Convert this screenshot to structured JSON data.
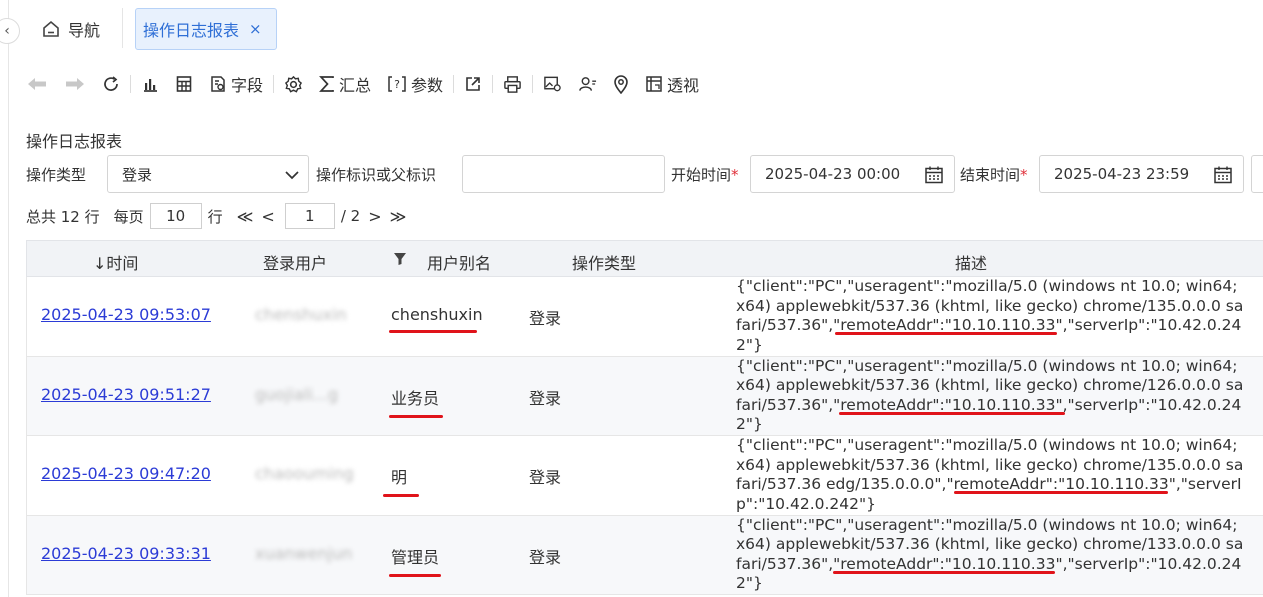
{
  "nav": {
    "home_label": "导航",
    "active_tab": "操作日志报表",
    "close_glyph": "×"
  },
  "toolbar": {
    "back_icon": "arrow-left-icon",
    "forward_icon": "arrow-right-icon",
    "field_label": "字段",
    "summary_label": "汇总",
    "param_label": "参数",
    "pivot_label": "透视"
  },
  "report": {
    "title": "操作日志报表"
  },
  "filters": {
    "op_type_label": "操作类型",
    "op_type_value": "登录",
    "op_id_label": "操作标识或父标识",
    "op_id_value": "",
    "start_label": "开始时间",
    "start_value": "2025-04-23 00:00",
    "end_label": "结束时间",
    "end_value": "2025-04-23 23:59",
    "required_mark": "*"
  },
  "pager": {
    "total_text": "总共 12 行",
    "per_page_label": "每页",
    "per_page_value": "10",
    "row_unit": "行",
    "first_glyph": "≪",
    "prev_glyph": "<",
    "current_page": "1",
    "page_total": "/ 2",
    "next_glyph": ">",
    "last_glyph": "≫"
  },
  "table": {
    "columns": {
      "time": "↓时间",
      "user": "登录用户",
      "alias": "用户别名",
      "type": "操作类型",
      "desc": "描述"
    },
    "rows": [
      {
        "time": "2025-04-23 09:53:07",
        "user": "chenshuxin",
        "alias": "chenshuxin",
        "type": "登录",
        "desc": "{\"client\":\"PC\",\"useragent\":\"mozilla/5.0 (windows nt 10.0; win64; x64) applewebkit/537.36 (khtml, like gecko) chrome/135.0.0.0 safari/537.36\",\"remoteAddr\":\"10.10.110.33\",\"serverIp\":\"10.42.0.242\"}"
      },
      {
        "time": "2025-04-23 09:51:27",
        "user": "guojiali...g",
        "alias": "业务员",
        "type": "登录",
        "desc": "{\"client\":\"PC\",\"useragent\":\"mozilla/5.0 (windows nt 10.0; win64; x64) applewebkit/537.36 (khtml, like gecko) chrome/126.0.0.0 safari/537.36\",\"remoteAddr\":\"10.10.110.33\",\"serverIp\":\"10.42.0.242\"}"
      },
      {
        "time": "2025-04-23 09:47:20",
        "user": "chaoouming",
        "alias": "明",
        "type": "登录",
        "desc": "{\"client\":\"PC\",\"useragent\":\"mozilla/5.0 (windows nt 10.0; win64; x64) applewebkit/537.36 (khtml, like gecko) chrome/135.0.0.0 safari/537.36 edg/135.0.0.0\",\"remoteAddr\":\"10.10.110.33\",\"serverIp\":\"10.42.0.242\"}"
      },
      {
        "time": "2025-04-23 09:33:31",
        "user": "xuanwenjun",
        "alias": "管理员",
        "type": "登录",
        "desc": "{\"client\":\"PC\",\"useragent\":\"mozilla/5.0 (windows nt 10.0; win64; x64) applewebkit/537.36 (khtml, like gecko) chrome/133.0.0.0 safari/537.36\",\"remoteAddr\":\"10.10.110.33\",\"serverIp\":\"10.42.0.242\"}"
      }
    ]
  },
  "colors": {
    "accent": "#2f6fd6",
    "link": "#2b3bd6",
    "highlight": "#e0131a"
  }
}
